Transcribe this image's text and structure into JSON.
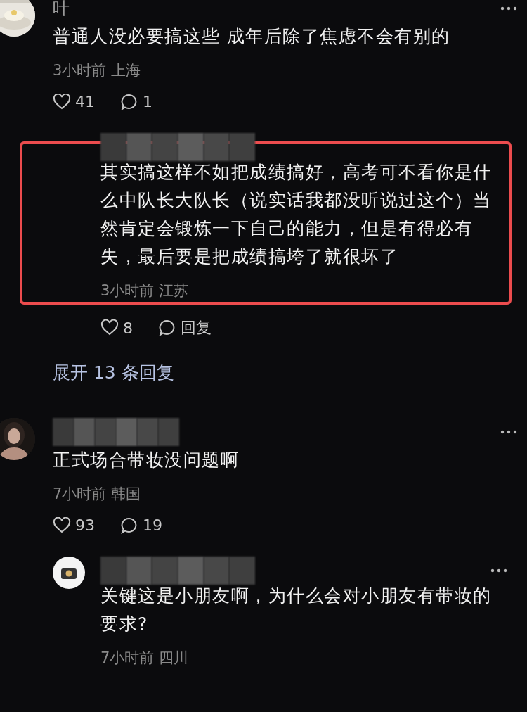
{
  "comments": [
    {
      "kind": "comment",
      "username": "叶",
      "avatar": {
        "kind": "picture"
      },
      "text": "普通人没必要搞这些 成年后除了焦虑不会有别的",
      "meta": "3小时前 上海",
      "likes": "41",
      "reply_action": "1",
      "children": [
        {
          "kind": "reply",
          "name_hidden": true,
          "highlighted": true,
          "text": "其实搞这样不如把成绩搞好，高考可不看你是什么中队长大队长（说实话我都没听说过这个）当然肯定会锻炼一下自己的能力，但是有得必有失，最后要是把成绩搞垮了就很坏了",
          "meta": "3小时前 江苏",
          "likes": "8",
          "reply_action": "回复"
        }
      ],
      "expand_link": "展开 13 条回复"
    },
    {
      "kind": "comment",
      "name_hidden": true,
      "avatar": {
        "kind": "picture"
      },
      "text": "正式场合带妆没问题啊",
      "meta": "7小时前 韩国",
      "likes": "93",
      "reply_action": "19",
      "children": [
        {
          "kind": "reply",
          "name_hidden": true,
          "avatar": {
            "kind": "icon"
          },
          "highlighted": false,
          "text": "关键这是小朋友啊，为什么会对小朋友有带妆的要求?",
          "meta": "7小时前 四川"
        }
      ]
    }
  ]
}
